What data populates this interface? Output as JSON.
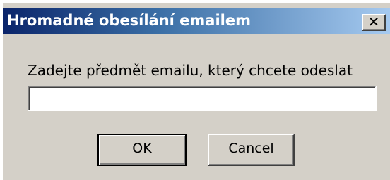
{
  "window": {
    "title": "Hromadné obesílání emailem",
    "close_glyph": "✕",
    "close_icon": "close-icon"
  },
  "dialog": {
    "prompt": "Zadejte předmět emailu, který chcete odeslat",
    "input_value": "",
    "ok_label": "OK",
    "cancel_label": "Cancel"
  },
  "colors": {
    "face": "#d4d0c8",
    "title_active_start": "#0a246a",
    "title_active_end": "#a6caf0",
    "title_text": "#ffffff"
  }
}
